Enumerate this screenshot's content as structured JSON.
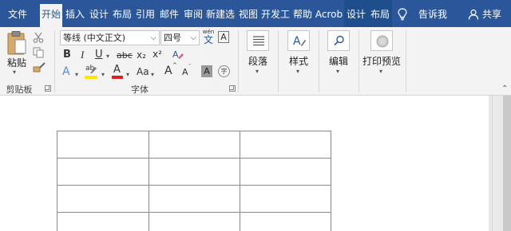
{
  "tabs": [
    {
      "label": "文件",
      "active": false
    },
    {
      "label": "开始",
      "active": true
    },
    {
      "label": "插入",
      "active": false
    },
    {
      "label": "设计",
      "active": false
    },
    {
      "label": "布局",
      "active": false
    },
    {
      "label": "引用",
      "active": false
    },
    {
      "label": "邮件",
      "active": false
    },
    {
      "label": "审阅",
      "active": false
    },
    {
      "label": "新建选",
      "active": false
    },
    {
      "label": "视图",
      "active": false
    },
    {
      "label": "开发工",
      "active": false
    },
    {
      "label": "帮助",
      "active": false
    },
    {
      "label": "Acrob",
      "active": false
    },
    {
      "label": "设计",
      "active": false,
      "contextual": true
    },
    {
      "label": "布局",
      "active": false,
      "contextual": true
    }
  ],
  "tell_me": "告诉我",
  "share": "共享",
  "clipboard": {
    "paste_label": "粘贴",
    "group_label": "剪贴板"
  },
  "font": {
    "font_name": "等线 (中文正文)",
    "font_size": "四号",
    "wen_glyph": "wén",
    "wen_char": "文",
    "a_box": "A",
    "bold": "B",
    "italic": "I",
    "underline": "U",
    "strike": "abc",
    "subscript": "x₂",
    "superscript": "x²",
    "case": "Aa",
    "grow": "A",
    "shrink": "A",
    "shade_a": "A",
    "font_color_a": "A",
    "group_label": "字体",
    "text_effect_a": "A",
    "highlight_glyph": "ab",
    "enclose_char": "字"
  },
  "paragraph": {
    "label": "段落"
  },
  "styles": {
    "label": "样式"
  },
  "editing": {
    "label": "编辑"
  },
  "print_preview": {
    "label": "打印预览"
  },
  "colors": {
    "accent": "#2b579a",
    "font_red": "#e02020",
    "highlight_yellow": "#ffe500"
  },
  "table": {
    "rows": 4,
    "cols": 3
  }
}
